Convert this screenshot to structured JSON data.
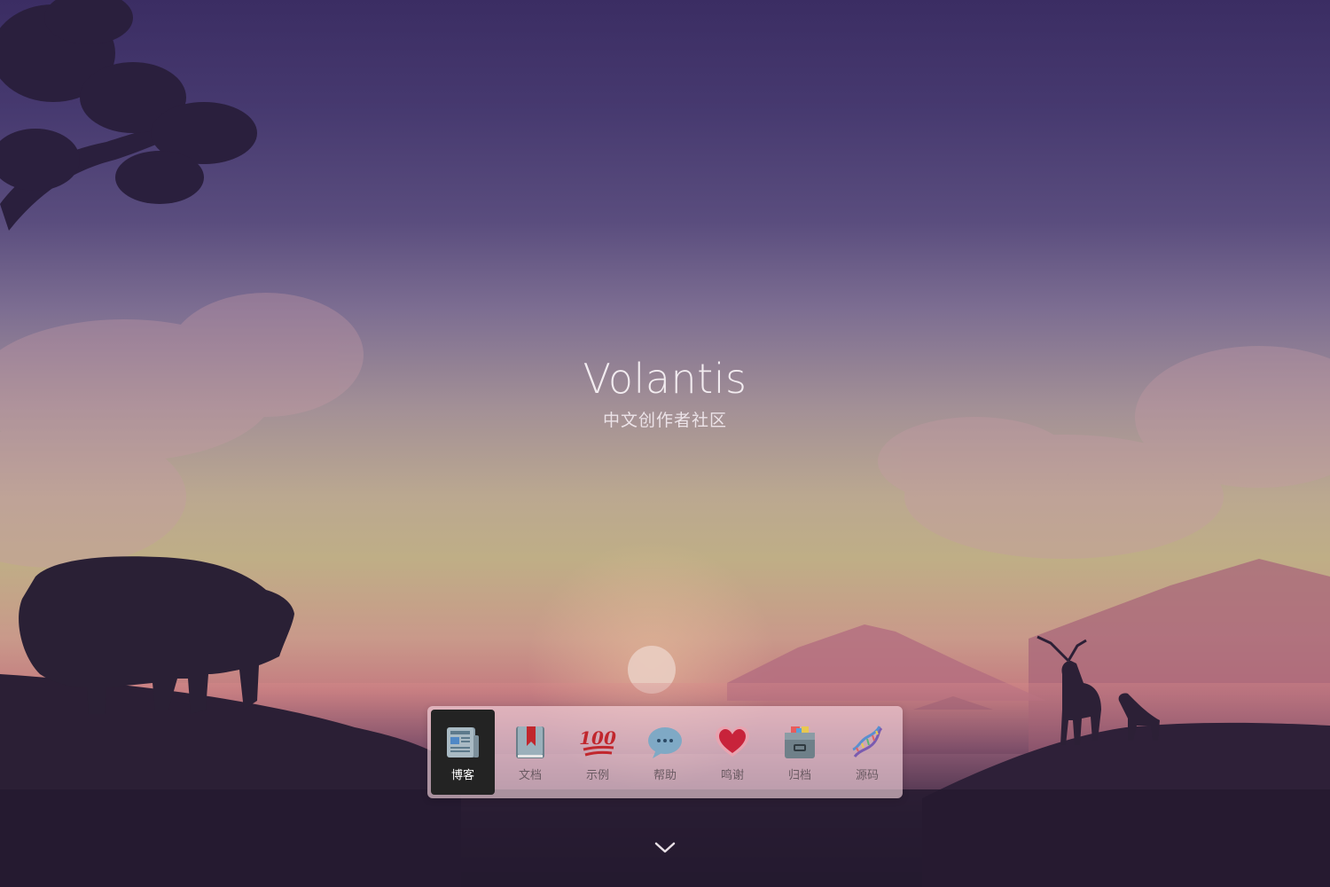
{
  "hero": {
    "title": "Volantis",
    "subtitle": "中文创作者社区"
  },
  "menu": {
    "items": [
      {
        "label": "博客",
        "icon": "newspaper-icon",
        "active": true
      },
      {
        "label": "文档",
        "icon": "book-bookmark-icon",
        "active": false
      },
      {
        "label": "示例",
        "icon": "hundred-points-icon",
        "active": false
      },
      {
        "label": "帮助",
        "icon": "speech-bubble-icon",
        "active": false
      },
      {
        "label": "鸣谢",
        "icon": "heart-icon",
        "active": false
      },
      {
        "label": "归档",
        "icon": "card-file-box-icon",
        "active": false
      },
      {
        "label": "源码",
        "icon": "dna-icon",
        "active": false
      }
    ]
  },
  "scroll": {
    "icon": "chevron-down-icon"
  },
  "colors": {
    "menu_bg": "#fadae2",
    "active_item_bg": "#232323",
    "title_text": "#f2ecf0",
    "silhouette": "#2a2035"
  }
}
